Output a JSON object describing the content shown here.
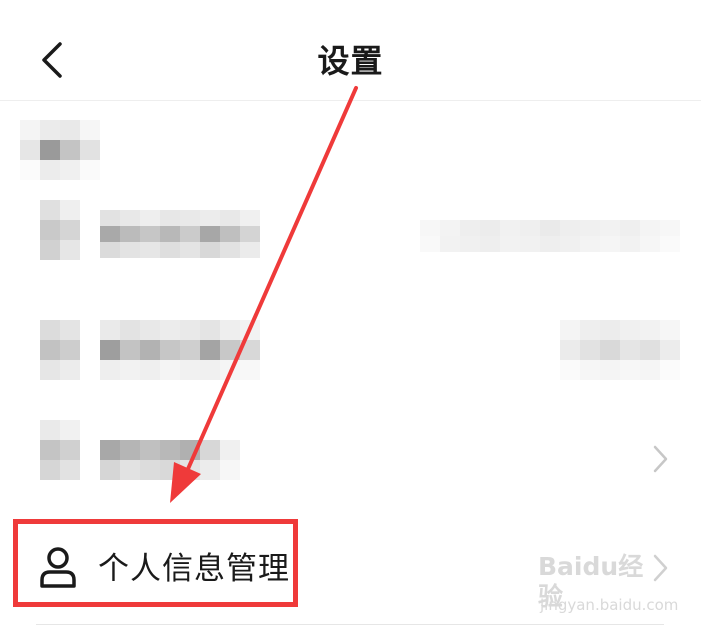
{
  "header": {
    "title": "设置",
    "back_icon": "chevron-left-icon"
  },
  "rows": [
    {
      "id": "row-1",
      "label_visible": false,
      "value_visible": false,
      "icon": "blurred"
    },
    {
      "id": "row-2",
      "label_visible": false,
      "value_visible": false,
      "icon": "blurred"
    },
    {
      "id": "row-3",
      "label_visible": false,
      "has_chevron": true,
      "icon": "blurred"
    }
  ],
  "personal_info": {
    "label": "个人信息管理",
    "icon": "person-icon",
    "has_chevron": true
  },
  "watermark": {
    "text": "Baidu经验",
    "sub": "jingyan.baidu.com"
  },
  "colors": {
    "annotation_red": "#ef3a3a",
    "text_primary": "#1a1a1a",
    "divider": "#eeeeee",
    "chevron": "#c7c7c7"
  }
}
